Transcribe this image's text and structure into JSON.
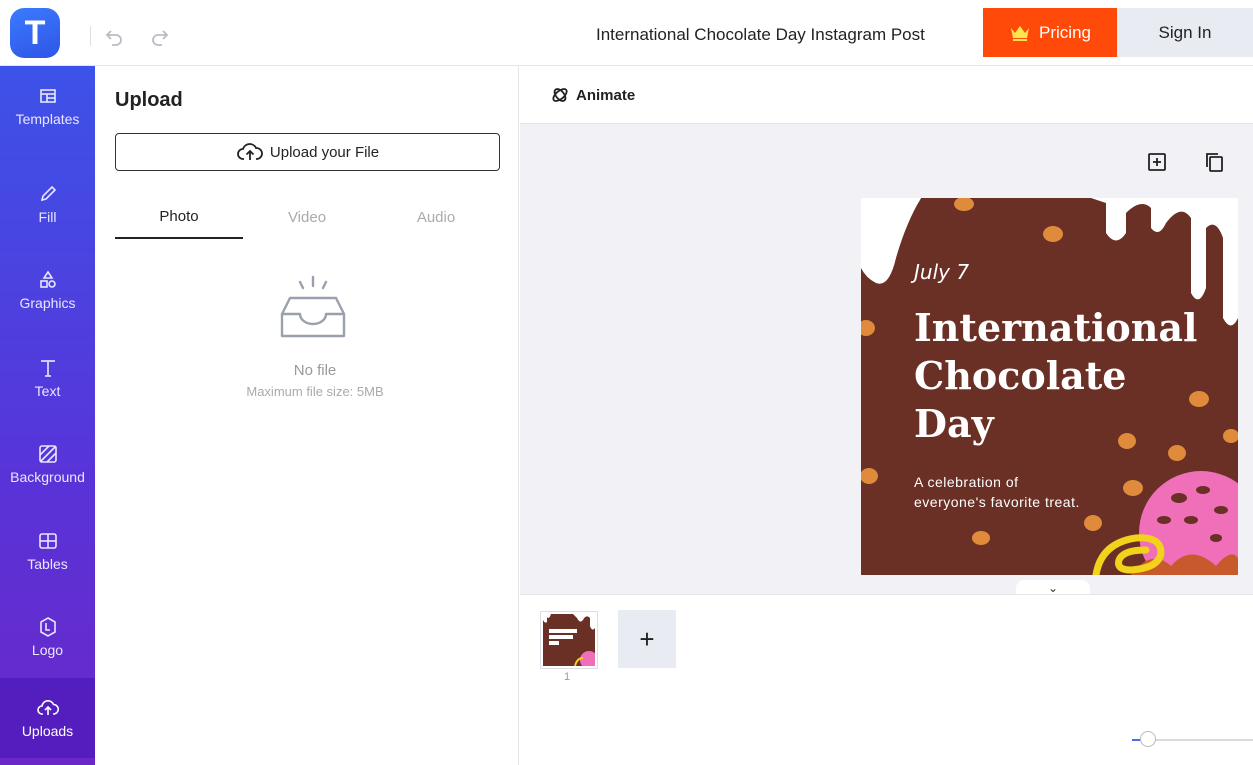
{
  "app": {
    "logo_letter": "T"
  },
  "header": {
    "document_title": "International Chocolate Day Instagram Post",
    "pricing_label": "Pricing",
    "signin_label": "Sign In"
  },
  "sidebar": {
    "items": [
      {
        "label": "Templates",
        "icon": "templates-icon"
      },
      {
        "label": "Fill",
        "icon": "pencil-icon"
      },
      {
        "label": "Graphics",
        "icon": "shapes-icon"
      },
      {
        "label": "Text",
        "icon": "text-icon"
      },
      {
        "label": "Background",
        "icon": "background-icon"
      },
      {
        "label": "Tables",
        "icon": "table-icon"
      },
      {
        "label": "Logo",
        "icon": "logo-icon"
      },
      {
        "label": "Uploads",
        "icon": "cloud-upload-icon",
        "active": true
      }
    ]
  },
  "upload_panel": {
    "title": "Upload",
    "upload_button_label": "Upload your File",
    "tabs": [
      {
        "label": "Photo",
        "active": true
      },
      {
        "label": "Video",
        "active": false
      },
      {
        "label": "Audio",
        "active": false
      }
    ],
    "empty_title": "No file",
    "empty_subtitle": "Maximum file size: 5MB"
  },
  "canvas_toolbar": {
    "animate_label": "Animate"
  },
  "design": {
    "date": "July 7",
    "title": "International Chocolate Day",
    "subtitle": "A celebration of everyone's favorite treat.",
    "colors": {
      "background": "#6a2f25",
      "drip": "#ffffff",
      "chips": "#e08a3c",
      "donut": "#ef6fb9",
      "swirl": "#f2d21a"
    }
  },
  "pages": {
    "thumbnails": [
      {
        "number": "1"
      }
    ],
    "add_label": "+"
  },
  "colors": {
    "accent": "#ff4a0a",
    "sidebar_top": "#3d52e8",
    "sidebar_bottom": "#6a28c9",
    "zoom": "#4a6cf0"
  }
}
